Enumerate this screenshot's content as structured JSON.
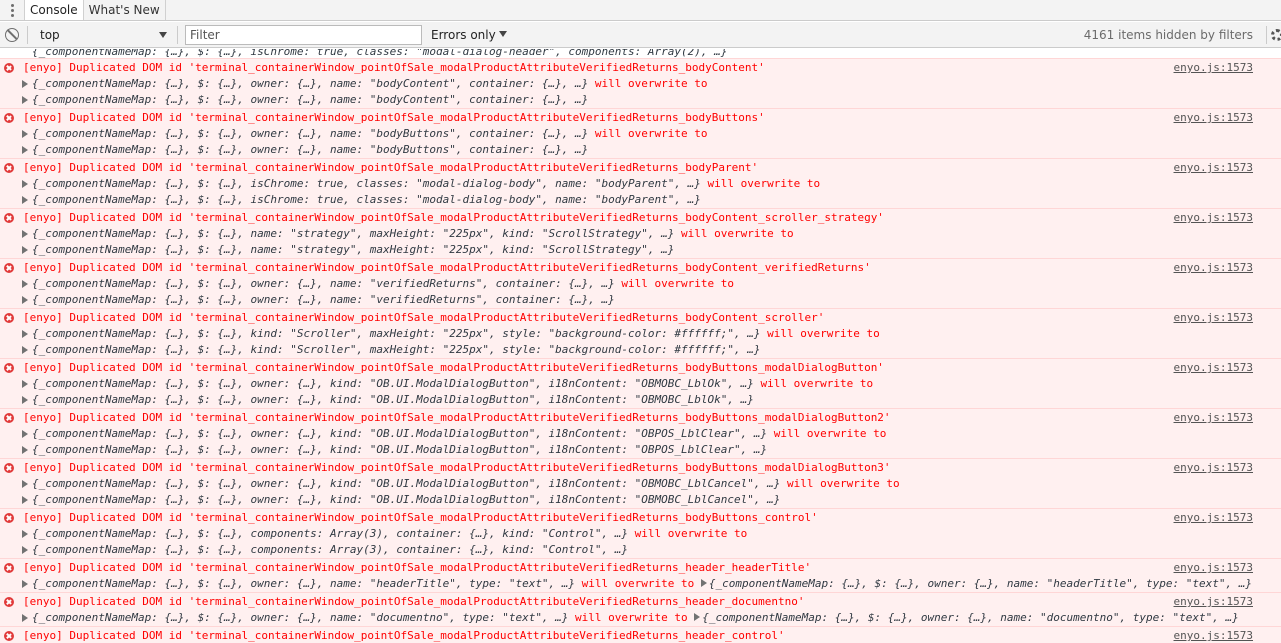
{
  "tabs": [
    {
      "label": "Console",
      "active": true
    },
    {
      "label": "What's New",
      "active": false
    }
  ],
  "toolbar": {
    "context": "top",
    "filter_placeholder": "Filter",
    "level": "Errors only",
    "hidden_count": "4161 items hidden by filters"
  },
  "partial_line": "{_componentNameMap: {…}, $: {…}, isChrome: true, classes: \"modal-dialog-header\", components: Array(2), …}",
  "entries": [
    {
      "message": "[enyo] Duplicated DOM id 'terminal_containerWindow_pointOfSale_modalProductAttributeVerifiedReturns_bodyContent'",
      "source": "enyo.js:1573",
      "line2": "{_componentNameMap: {…}, $: {…}, owner: {…}, name: \"bodyContent\", container: {…}, …}",
      "tail": " will overwrite to",
      "line3": "{_componentNameMap: {…}, $: {…}, owner: {…}, name: \"bodyContent\", container: {…}, …}"
    },
    {
      "message": "[enyo] Duplicated DOM id 'terminal_containerWindow_pointOfSale_modalProductAttributeVerifiedReturns_bodyButtons'",
      "source": "enyo.js:1573",
      "line2": "{_componentNameMap: {…}, $: {…}, owner: {…}, name: \"bodyButtons\", container: {…}, …}",
      "tail": " will overwrite to",
      "line3": "{_componentNameMap: {…}, $: {…}, owner: {…}, name: \"bodyButtons\", container: {…}, …}"
    },
    {
      "message": "[enyo] Duplicated DOM id 'terminal_containerWindow_pointOfSale_modalProductAttributeVerifiedReturns_bodyParent'",
      "source": "enyo.js:1573",
      "line2": "{_componentNameMap: {…}, $: {…}, isChrome: true, classes: \"modal-dialog-body\", name: \"bodyParent\", …}",
      "tail": " will overwrite to",
      "line3": "{_componentNameMap: {…}, $: {…}, isChrome: true, classes: \"modal-dialog-body\", name: \"bodyParent\", …}"
    },
    {
      "message": "[enyo] Duplicated DOM id 'terminal_containerWindow_pointOfSale_modalProductAttributeVerifiedReturns_bodyContent_scroller_strategy'",
      "source": "enyo.js:1573",
      "line2": "{_componentNameMap: {…}, $: {…}, name: \"strategy\", maxHeight: \"225px\", kind: \"ScrollStrategy\", …}",
      "tail": " will overwrite to",
      "line3": "{_componentNameMap: {…}, $: {…}, name: \"strategy\", maxHeight: \"225px\", kind: \"ScrollStrategy\", …}"
    },
    {
      "message": "[enyo] Duplicated DOM id 'terminal_containerWindow_pointOfSale_modalProductAttributeVerifiedReturns_bodyContent_verifiedReturns'",
      "source": "enyo.js:1573",
      "line2": "{_componentNameMap: {…}, $: {…}, owner: {…}, name: \"verifiedReturns\", container: {…}, …}",
      "tail": " will overwrite to",
      "line3": "{_componentNameMap: {…}, $: {…}, owner: {…}, name: \"verifiedReturns\", container: {…}, …}"
    },
    {
      "message": "[enyo] Duplicated DOM id 'terminal_containerWindow_pointOfSale_modalProductAttributeVerifiedReturns_bodyContent_scroller'",
      "source": "enyo.js:1573",
      "line2": "{_componentNameMap: {…}, $: {…}, kind: \"Scroller\", maxHeight: \"225px\", style: \"background-color: #ffffff;\", …}",
      "tail": " will overwrite to",
      "line3": "{_componentNameMap: {…}, $: {…}, kind: \"Scroller\", maxHeight: \"225px\", style: \"background-color: #ffffff;\", …}"
    },
    {
      "message": "[enyo] Duplicated DOM id 'terminal_containerWindow_pointOfSale_modalProductAttributeVerifiedReturns_bodyButtons_modalDialogButton'",
      "source": "enyo.js:1573",
      "line2": "{_componentNameMap: {…}, $: {…}, owner: {…}, kind: \"OB.UI.ModalDialogButton\", i18nContent: \"OBMOBC_LblOk\", …}",
      "tail": " will overwrite to",
      "line3": "{_componentNameMap: {…}, $: {…}, owner: {…}, kind: \"OB.UI.ModalDialogButton\", i18nContent: \"OBMOBC_LblOk\", …}"
    },
    {
      "message": "[enyo] Duplicated DOM id 'terminal_containerWindow_pointOfSale_modalProductAttributeVerifiedReturns_bodyButtons_modalDialogButton2'",
      "source": "enyo.js:1573",
      "line2": "{_componentNameMap: {…}, $: {…}, owner: {…}, kind: \"OB.UI.ModalDialogButton\", i18nContent: \"OBPOS_LblClear\", …}",
      "tail": " will overwrite to",
      "line3": "{_componentNameMap: {…}, $: {…}, owner: {…}, kind: \"OB.UI.ModalDialogButton\", i18nContent: \"OBPOS_LblClear\", …}"
    },
    {
      "message": "[enyo] Duplicated DOM id 'terminal_containerWindow_pointOfSale_modalProductAttributeVerifiedReturns_bodyButtons_modalDialogButton3'",
      "source": "enyo.js:1573",
      "line2": "{_componentNameMap: {…}, $: {…}, owner: {…}, kind: \"OB.UI.ModalDialogButton\", i18nContent: \"OBMOBC_LblCancel\", …}",
      "tail": " will overwrite to",
      "line3": "{_componentNameMap: {…}, $: {…}, owner: {…}, kind: \"OB.UI.ModalDialogButton\", i18nContent: \"OBMOBC_LblCancel\", …}"
    },
    {
      "message": "[enyo] Duplicated DOM id 'terminal_containerWindow_pointOfSale_modalProductAttributeVerifiedReturns_bodyButtons_control'",
      "source": "enyo.js:1573",
      "line2": "{_componentNameMap: {…}, $: {…}, components: Array(3), container: {…}, kind: \"Control\", …}",
      "tail": " will overwrite to",
      "line3": "{_componentNameMap: {…}, $: {…}, components: Array(3), container: {…}, kind: \"Control\", …}"
    }
  ],
  "wide_entries": [
    {
      "message": "[enyo] Duplicated DOM id 'terminal_containerWindow_pointOfSale_modalProductAttributeVerifiedReturns_header_headerTitle'",
      "source": "enyo.js:1573",
      "line2": "{_componentNameMap: {…}, $: {…}, owner: {…}, name: \"headerTitle\", type: \"text\", …}",
      "tail": " will overwrite to ",
      "line2b": "{_componentNameMap: {…}, $: {…}, owner: {…}, name: \"headerTitle\", type: \"text\", …}"
    },
    {
      "message": "[enyo] Duplicated DOM id 'terminal_containerWindow_pointOfSale_modalProductAttributeVerifiedReturns_header_documentno'",
      "source": "enyo.js:1573",
      "line2": "{_componentNameMap: {…}, $: {…}, owner: {…}, name: \"documentno\", type: \"text\", …}",
      "tail": " will overwrite to ",
      "line2b": "{_componentNameMap: {…}, $: {…}, owner: {…}, name: \"documentno\", type: \"text\", …}"
    },
    {
      "message": "[enyo] Duplicated DOM id 'terminal_containerWindow_pointOfSale_modalProductAttributeVerifiedReturns_header_control'",
      "source": "enyo.js:1573",
      "line2": "",
      "tail": "",
      "line2b": ""
    }
  ]
}
